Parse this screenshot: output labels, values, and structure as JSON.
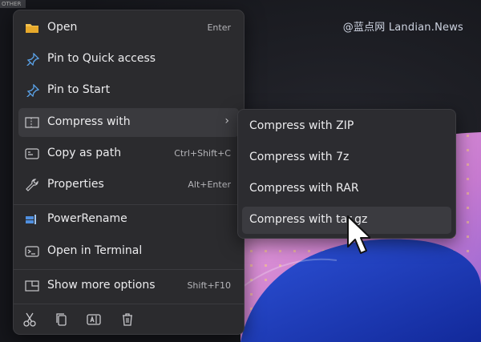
{
  "watermark": "@蓝点网 Landian.News",
  "corner_tab": "OTHER",
  "menu": {
    "items": [
      {
        "label": "Open",
        "shortcut": "Enter",
        "icon": "folder-icon"
      },
      {
        "label": "Pin to Quick access",
        "shortcut": "",
        "icon": "pin-icon"
      },
      {
        "label": "Pin to Start",
        "shortcut": "",
        "icon": "pin-icon"
      },
      {
        "label": "Compress with",
        "shortcut": "",
        "icon": "zip-icon",
        "submenu_arrow": "›"
      },
      {
        "label": "Copy as path",
        "shortcut": "Ctrl+Shift+C",
        "icon": "path-icon"
      },
      {
        "label": "Properties",
        "shortcut": "Alt+Enter",
        "icon": "wrench-icon"
      },
      {
        "label": "PowerRename",
        "shortcut": "",
        "icon": "powerrename-icon"
      },
      {
        "label": "Open in Terminal",
        "shortcut": "",
        "icon": "terminal-icon"
      },
      {
        "label": "Show more options",
        "shortcut": "Shift+F10",
        "icon": "more-options-icon"
      }
    ],
    "bottom_actions": [
      "cut-icon",
      "copy-icon",
      "rename-icon",
      "delete-icon"
    ]
  },
  "submenu": {
    "items": [
      {
        "label": "Compress with ZIP"
      },
      {
        "label": "Compress with 7z"
      },
      {
        "label": "Compress with RAR"
      },
      {
        "label": "Compress with tar.gz"
      }
    ]
  },
  "colors": {
    "menu_bg": "#2b2b2e",
    "highlight": "#3a3a3e",
    "accent_blue": "#4f8fe0",
    "wallpaper_pink": "#e79bd5",
    "wallpaper_blue": "#1f3fb8"
  }
}
